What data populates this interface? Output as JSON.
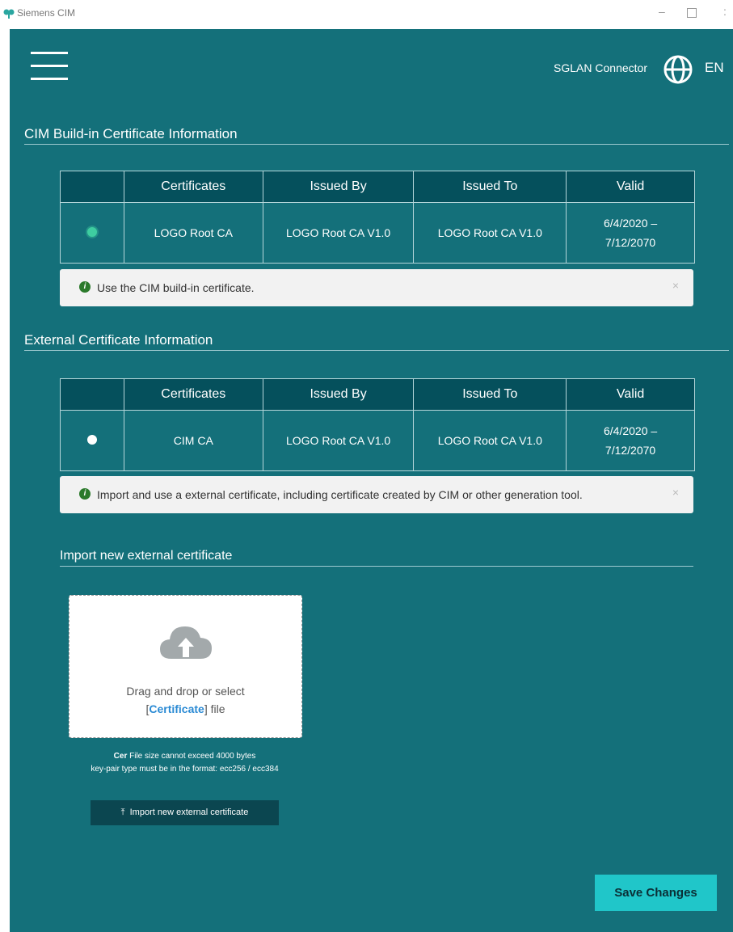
{
  "window": {
    "title": "Siemens CIM",
    "minimize": "–",
    "more": ":"
  },
  "header": {
    "connector": "SGLAN Connector",
    "language": "EN"
  },
  "builtin": {
    "title": "CIM Build-in Certificate Information",
    "headers": [
      "Certificates",
      "Issued By",
      "Issued To",
      "Valid"
    ],
    "row": {
      "certificate": "LOGO Root CA",
      "issued_by": "LOGO Root CA V1.0",
      "issued_to": "LOGO Root CA V1.0",
      "valid_from": "6/4/2020 –",
      "valid_to": "7/12/2070",
      "selected": true
    },
    "alert": "Use the CIM build-in certificate."
  },
  "external": {
    "title": "External Certificate Information",
    "headers": [
      "Certificates",
      "Issued By",
      "Issued To",
      "Valid"
    ],
    "row": {
      "certificate": "CIM CA",
      "issued_by": "LOGO Root CA V1.0",
      "issued_to": "LOGO Root CA V1.0",
      "valid_from": "6/4/2020 –",
      "valid_to": "7/12/2070",
      "selected": false
    },
    "alert": "Import and use a external certificate, including certificate created by CIM or other generation tool."
  },
  "import": {
    "title": "Import new external certificate",
    "drop_line1": "Drag and drop or select",
    "drop_bracket_open": "[",
    "drop_link": "Certificate",
    "drop_bracket_close": "] file",
    "hint_bold": "Cer",
    "hint_line1": " File size cannot exceed 4000 bytes",
    "hint_line2": "key-pair type must be in the format: ecc256 / ecc384",
    "button_icon": "⤒",
    "button_label": "Import new external certificate"
  },
  "footer": {
    "save_label": "Save Changes"
  },
  "icons": {
    "alert": "i",
    "close": "×"
  },
  "colors": {
    "background": "#14707a",
    "header_row": "#05505c",
    "save_button": "#20c6c9",
    "selected_radio": "#3ecda0"
  }
}
